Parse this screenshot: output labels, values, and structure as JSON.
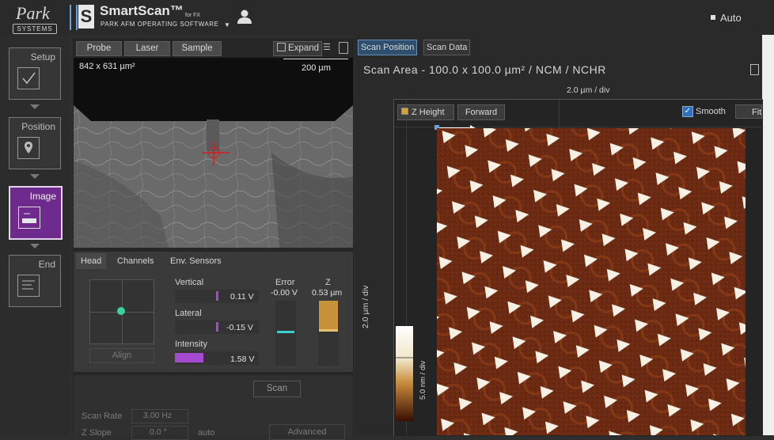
{
  "header": {
    "logo_top": "Park",
    "logo_bottom": "SYSTEMS",
    "app_title": "SmartScan™",
    "app_for": "for FX",
    "app_subtitle": "PARK AFM OPERATING SOFTWARE",
    "mode_label": "Auto"
  },
  "workflow": {
    "steps": [
      {
        "label": "Setup"
      },
      {
        "label": "Position"
      },
      {
        "label": "Image"
      },
      {
        "label": "End"
      }
    ],
    "active_step": "Image"
  },
  "probe_panel": {
    "tabs": [
      "Probe",
      "Laser",
      "Sample"
    ],
    "expand_label": "Expand",
    "camera": {
      "fov_label": "842 x 631 µm²",
      "scale_label": "200 µm"
    },
    "head_tabs": [
      "Head",
      "Channels",
      "Env. Sensors"
    ],
    "align_label": "Align",
    "vertical": {
      "label": "Vertical",
      "value": "0.11 V"
    },
    "lateral": {
      "label": "Lateral",
      "value": "-0.15 V"
    },
    "intensity": {
      "label": "Intensity",
      "value": "1.58 V"
    },
    "error": {
      "label": "Error",
      "value": "-0.00 V"
    },
    "z": {
      "label": "Z",
      "value": "0.53 µm"
    },
    "scan_button": "Scan",
    "scan_rate": {
      "label": "Scan Rate",
      "value": "3.00 Hz"
    },
    "z_slope": {
      "label": "Z Slope",
      "value": "0.0 °",
      "mode": "auto"
    },
    "advanced_label": "Advanced"
  },
  "main": {
    "tabs": [
      "Scan Position",
      "Scan Data"
    ],
    "active_tab": "Scan Position",
    "scan_area_title": "Scan Area  -  100.0 x 100.0 µm² / NCM / NCHR",
    "x_div_label": "2.0 µm / div",
    "y_div_label": "2.0 µm / div",
    "channel_label": "Z Height",
    "direction_label": "Forward",
    "smooth_label": "Smooth",
    "smooth_checked": true,
    "fit_label": "Fit",
    "colorbar_label": "5.0 nm / div"
  },
  "colors": {
    "accent_purple": "#6e2b8d",
    "afm_background": "#6e2a10",
    "afm_feature": "#f4f0e2",
    "tab_highlight": "#2f4f6e"
  }
}
